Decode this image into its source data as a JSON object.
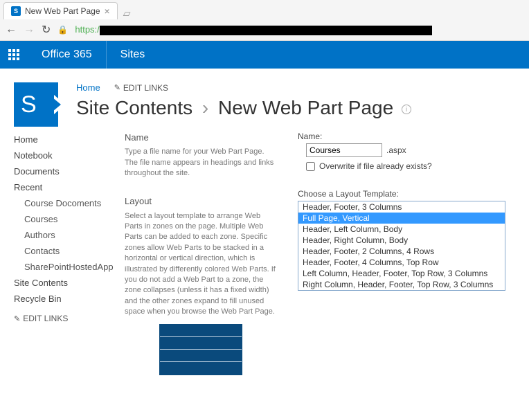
{
  "browser": {
    "tab_title": "New Web Part Page",
    "url_scheme": "https:/"
  },
  "suite": {
    "brand": "Office 365",
    "title": "Sites"
  },
  "breadcrumb": {
    "home": "Home",
    "edit_links": "EDIT LINKS"
  },
  "page_title": {
    "part1": "Site Contents",
    "part2": "New Web Part Page"
  },
  "left_nav": {
    "items": [
      "Home",
      "Notebook",
      "Documents",
      "Recent"
    ],
    "recent_children": [
      "Course Docoments",
      "Courses",
      "Authors",
      "Contacts",
      "SharePointHostedApp"
    ],
    "tail": [
      "Site Contents",
      "Recycle Bin"
    ],
    "edit": "EDIT LINKS"
  },
  "form": {
    "name_section": {
      "heading": "Name",
      "desc": "Type a file name for your Web Part Page. The file name appears in headings and links throughout the site.",
      "label": "Name:",
      "value": "Courses",
      "ext": ".aspx",
      "overwrite_label": "Overwrite if file already exists?"
    },
    "layout_section": {
      "heading": "Layout",
      "desc": "Select a layout template to arrange Web Parts in zones on the page. Multiple Web Parts can be added to each zone. Specific zones allow Web Parts to be stacked in a horizontal or vertical direction, which is illustrated by differently colored Web Parts. If you do not add a Web Part to a zone, the zone collapses (unless it has a fixed width) and the other zones expand to fill unused space when you browse the Web Part Page.",
      "label": "Choose a Layout Template:",
      "options": [
        "Header, Footer, 3 Columns",
        "Full Page, Vertical",
        "Header, Left Column, Body",
        "Header, Right Column, Body",
        "Header, Footer, 2 Columns, 4 Rows",
        "Header, Footer, 4 Columns, Top Row",
        "Left Column, Header, Footer, Top Row, 3 Columns",
        "Right Column, Header, Footer, Top Row, 3 Columns"
      ],
      "selected_index": 1
    }
  }
}
